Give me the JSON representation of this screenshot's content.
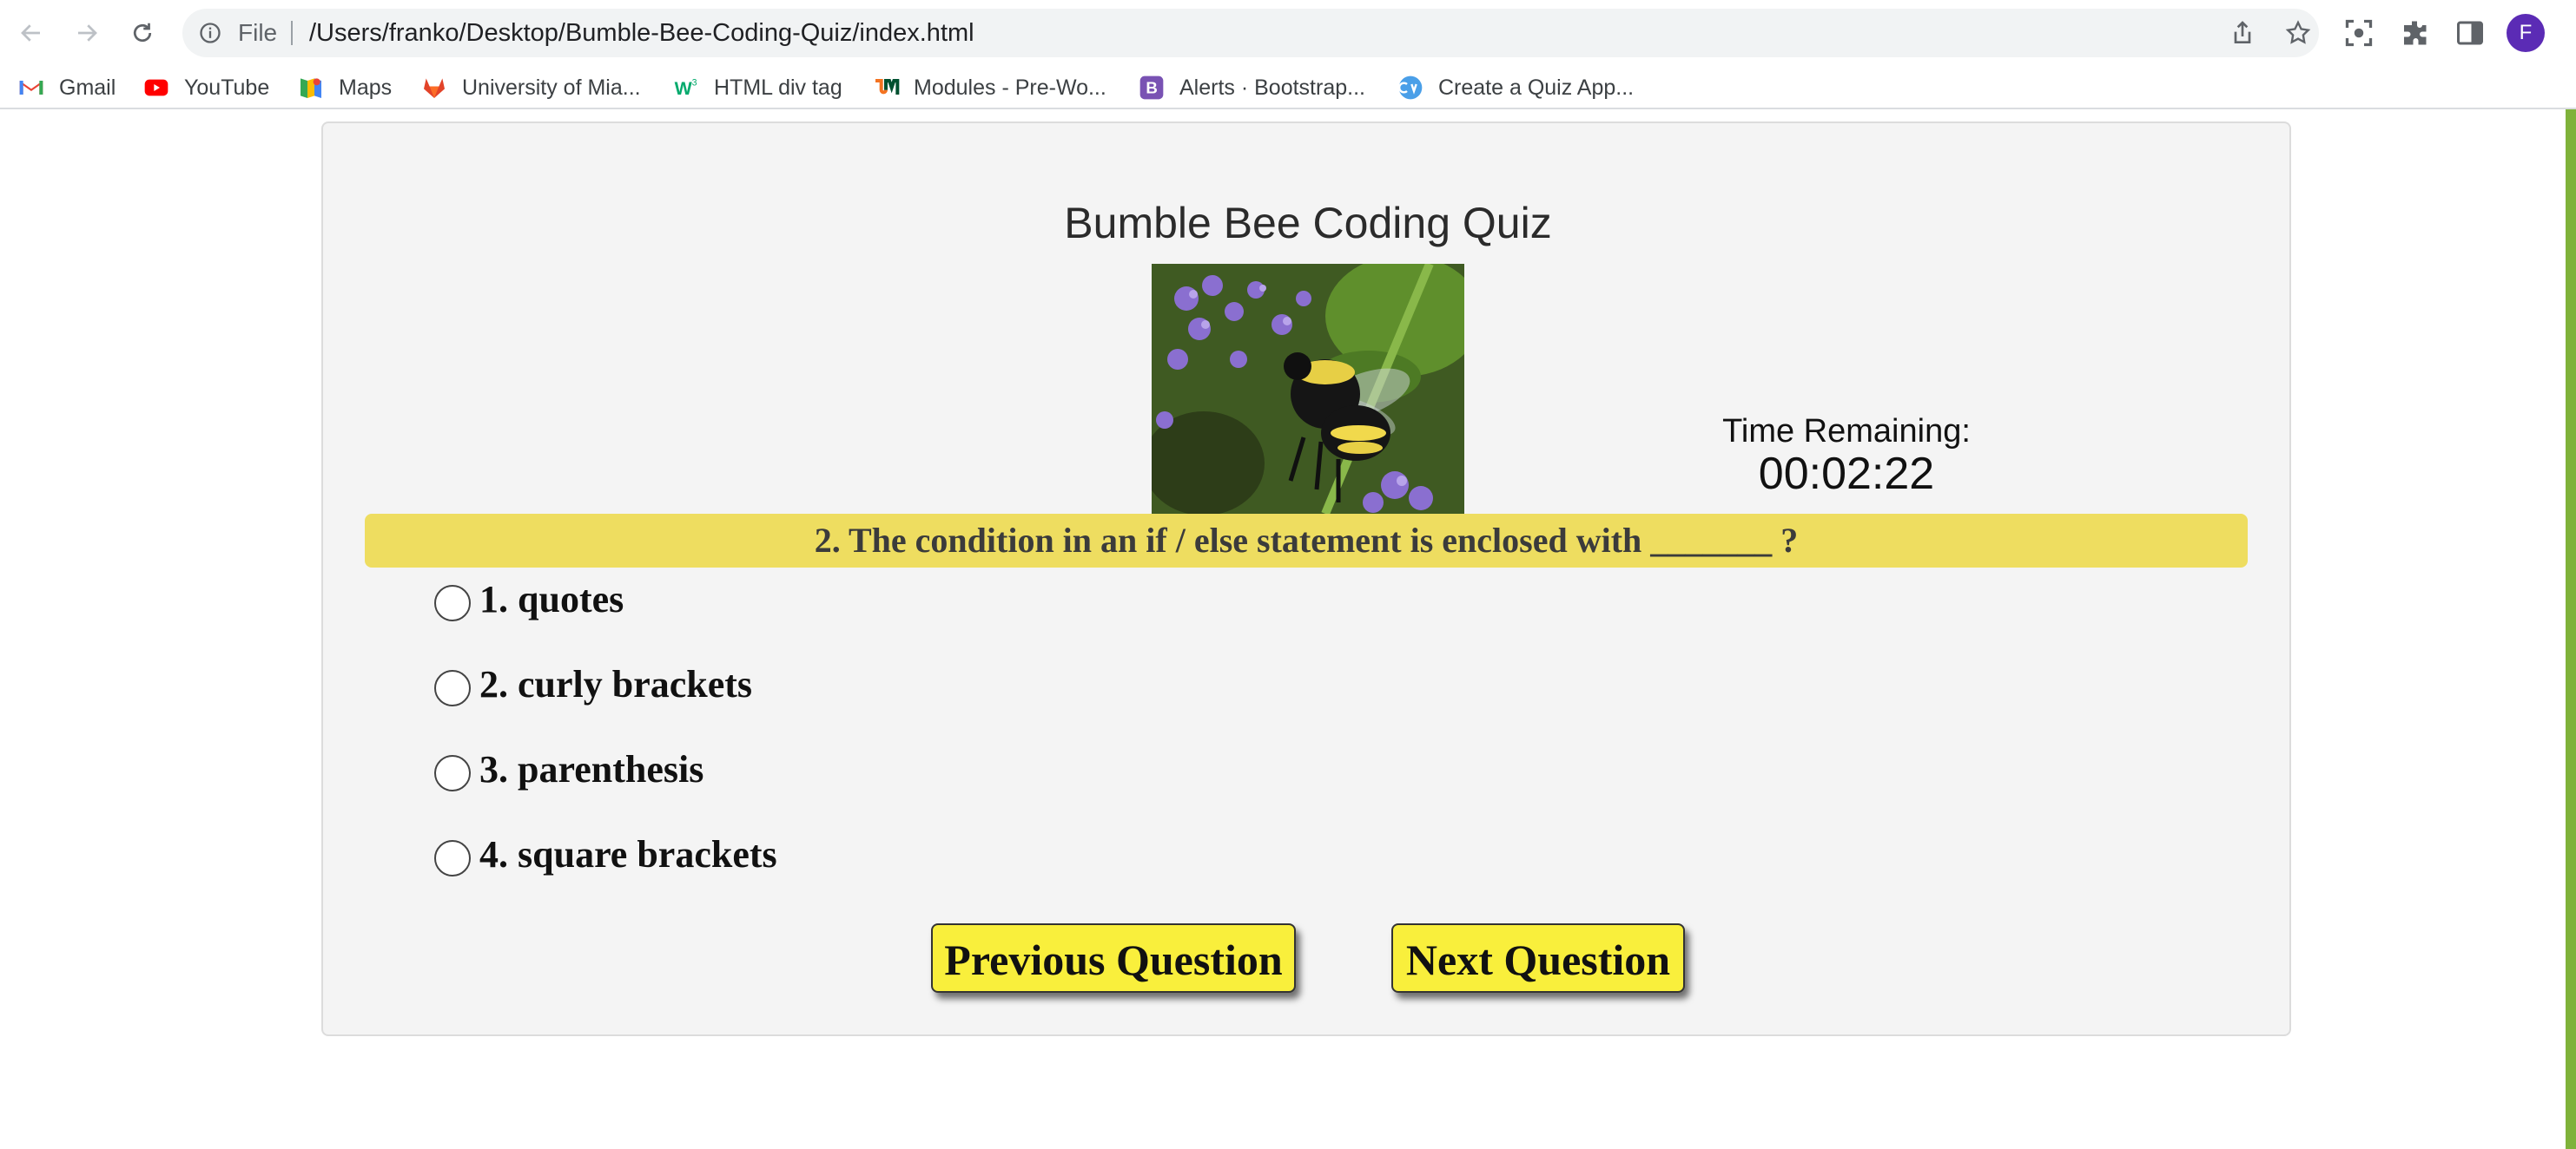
{
  "browser": {
    "omnibox": {
      "scheme_label": "File",
      "url": "/Users/franko/Desktop/Bumble-Bee-Coding-Quiz/index.html"
    },
    "profile_initial": "F",
    "bookmarks": [
      {
        "label": "Gmail",
        "icon": "gmail-icon"
      },
      {
        "label": "YouTube",
        "icon": "youtube-icon"
      },
      {
        "label": "Maps",
        "icon": "maps-icon"
      },
      {
        "label": "University of Mia...",
        "icon": "gitlab-icon"
      },
      {
        "label": "HTML div tag",
        "icon": "w3schools-icon"
      },
      {
        "label": "Modules - Pre-Wo...",
        "icon": "um-icon"
      },
      {
        "label": "Alerts · Bootstrap...",
        "icon": "bootstrap-icon"
      },
      {
        "label": "Create a Quiz App...",
        "icon": "quiz-app-icon"
      }
    ]
  },
  "quiz": {
    "title": "Bumble Bee Coding Quiz",
    "timer_label": "Time Remaining:",
    "timer_value": "00:02:22",
    "question": "2. The condition in an if / else statement is enclosed with _______ ?",
    "options": [
      {
        "label": "1. quotes",
        "selected": false
      },
      {
        "label": "2. curly brackets",
        "selected": false
      },
      {
        "label": "3. parenthesis",
        "selected": false
      },
      {
        "label": "4. square brackets",
        "selected": false
      }
    ],
    "prev_label": "Previous Question",
    "next_label": "Next Question"
  },
  "colors": {
    "question_bar": "#eedd60",
    "button": "#f9ef3c",
    "card": "#f4f4f4",
    "accent_right": "#7fb23a",
    "profile": "#5b2bb5"
  }
}
